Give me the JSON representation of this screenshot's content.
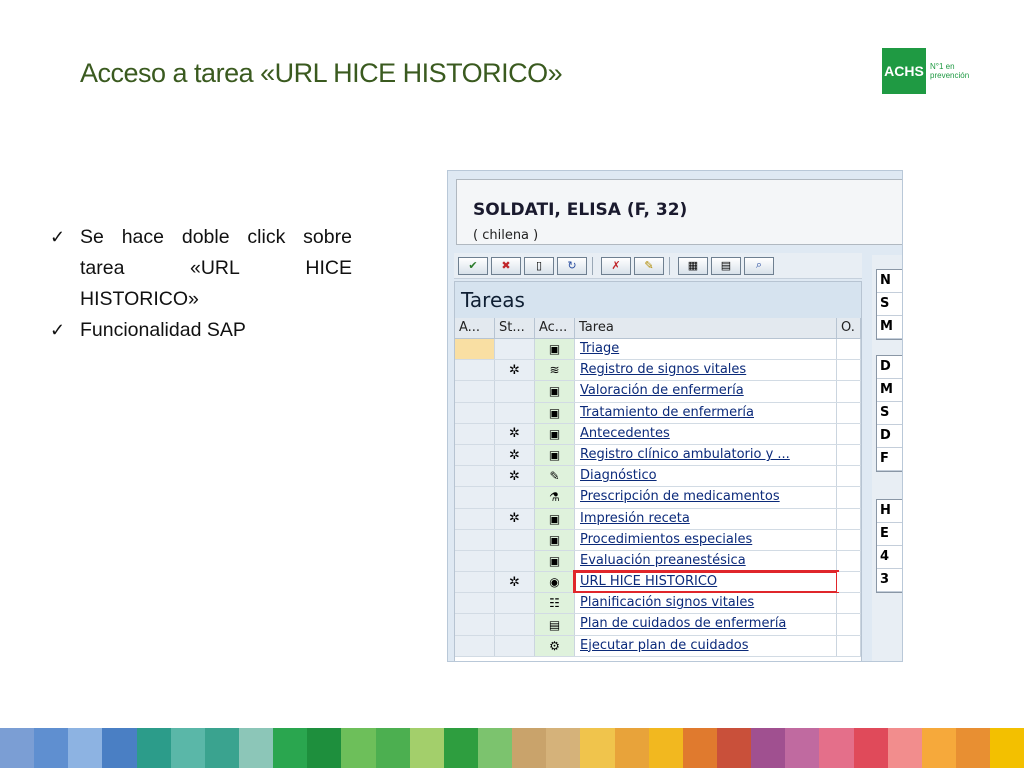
{
  "slide": {
    "title": "Acceso a tarea «URL HICE HISTORICO»",
    "logo": {
      "text": "ACHS",
      "tagline_line1": "N°1 en",
      "tagline_line2": "prevención"
    },
    "bullets": [
      {
        "icon": "checkmark-icon",
        "lines": [
          [
            "Se",
            "hace",
            "doble",
            "click",
            "sobre"
          ],
          [
            "tarea",
            "«URL",
            "HICE"
          ],
          [
            "HISTORICO»"
          ]
        ]
      },
      {
        "icon": "checkmark-icon",
        "lines": [
          [
            "Funcionalidad SAP"
          ]
        ]
      }
    ]
  },
  "sap": {
    "patient_name": "SOLDATI, ELISA (F, 32)",
    "patient_nationality": "( chilena )",
    "panel_title": "Tareas",
    "columns": [
      "A...",
      "St...",
      "Ac...",
      "Tarea",
      "O."
    ],
    "tasks": [
      {
        "label": "Triage",
        "status_icon": "",
        "action_icon": "▣"
      },
      {
        "label": "Registro de signos vitales",
        "status_icon": "✲",
        "action_icon": "≋"
      },
      {
        "label": "Valoración de enfermería",
        "status_icon": "",
        "action_icon": "▣"
      },
      {
        "label": "Tratamiento de enfermería",
        "status_icon": "",
        "action_icon": "▣"
      },
      {
        "label": "Antecedentes",
        "status_icon": "✲",
        "action_icon": "▣"
      },
      {
        "label": "Registro clínico ambulatorio y ...",
        "status_icon": "✲",
        "action_icon": "▣"
      },
      {
        "label": "Diagnóstico",
        "status_icon": "✲",
        "action_icon": "✎"
      },
      {
        "label": "Prescripción de medicamentos",
        "status_icon": "",
        "action_icon": "⚗"
      },
      {
        "label": "Impresión receta",
        "status_icon": "✲",
        "action_icon": "▣"
      },
      {
        "label": "Procedimientos especiales",
        "status_icon": "",
        "action_icon": "▣"
      },
      {
        "label": "Evaluación preanestésica",
        "status_icon": "",
        "action_icon": "▣"
      },
      {
        "label": "URL HICE HISTORICO",
        "status_icon": "✲",
        "action_icon": "◉"
      },
      {
        "label": "Planificación signos vitales",
        "status_icon": "",
        "action_icon": "☷"
      },
      {
        "label": "Plan de cuidados de enfermería",
        "status_icon": "",
        "action_icon": "▤"
      },
      {
        "label": "Ejecutar plan de cuidados",
        "status_icon": "",
        "action_icon": "⚙"
      }
    ],
    "selected_task": "URL HICE HISTORICO",
    "right_panel_cells": [
      [
        "N",
        "S",
        "M"
      ],
      [
        "D",
        "M",
        "S",
        "D",
        "F"
      ],
      [
        "H",
        "E",
        "4",
        "3"
      ]
    ],
    "highlight_color": "#e0262b"
  },
  "footer_stripe_colors": [
    "#7b9ed4",
    "#5f8fd0",
    "#8db3e2",
    "#4a7fc4",
    "#2c9c8a",
    "#5ab7a8",
    "#3aa38f",
    "#8cc6b8",
    "#2aa64f",
    "#1e8f3d",
    "#6dbf5a",
    "#4caf50",
    "#a3cf6b",
    "#2e9e3f",
    "#7cc36e",
    "#c9a36b",
    "#d5b27a",
    "#f0c44c",
    "#e8a33a",
    "#f2b81f",
    "#e07a2e",
    "#c9503a",
    "#a05090",
    "#c06aa0",
    "#e46f8a",
    "#e04a5a",
    "#f28d8d",
    "#f6a93b",
    "#e88f32",
    "#f3c000"
  ]
}
